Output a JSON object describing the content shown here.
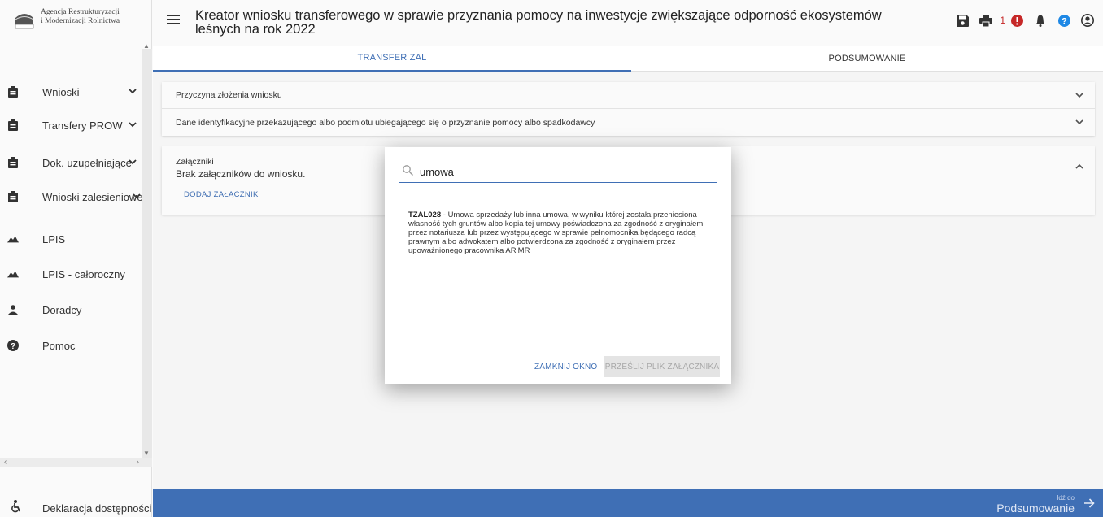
{
  "logo": {
    "line1": "Agencja Restrukturyzacji",
    "line2": "i Modernizacji Rolnictwa",
    "mark_text": "ARiMR"
  },
  "sidebar": {
    "items": [
      {
        "label": "Wnioski",
        "icon": "clipboard-icon",
        "has_chevron": true
      },
      {
        "label": "Transfery PROW",
        "icon": "clipboard-icon",
        "has_chevron": true
      },
      {
        "label": "Dok. uzupełniające",
        "icon": "clipboard-icon",
        "has_chevron": true
      },
      {
        "label": "Wnioski zalesieniowe",
        "icon": "clipboard-icon",
        "has_chevron": true
      },
      {
        "label": "LPIS",
        "icon": "terrain-icon",
        "has_chevron": false
      },
      {
        "label": "LPIS - całoroczny",
        "icon": "terrain-icon",
        "has_chevron": false
      },
      {
        "label": "Doradcy",
        "icon": "person-icon",
        "has_chevron": false
      },
      {
        "label": "Pomoc",
        "icon": "help-icon",
        "has_chevron": false
      }
    ],
    "accessibility_label": "Deklaracja dostępności"
  },
  "header": {
    "title": "Kreator wniosku transferowego w sprawie przyznania pomocy na inwestycje zwiększające odporność ekosystemów leśnych na rok 2022",
    "error_count": "1"
  },
  "tabs": [
    {
      "label": "TRANSFER ZAL",
      "active": true
    },
    {
      "label": "PODSUMOWANIE",
      "active": false
    }
  ],
  "sections": {
    "reason": "Przyczyna złożenia wniosku",
    "identification": "Dane identyfikacyjne przekazującego albo podmiotu ubiegającego się o przyznanie pomocy albo spadkodawcy",
    "attachments_title": "Załączniki",
    "attachments_empty": "Brak załączników do wniosku.",
    "add_attachment": "DODAJ ZAŁĄCZNIK"
  },
  "modal": {
    "search_value": "umowa",
    "result_code": "TZAL028",
    "result_text": " - Umowa sprzedaży lub inna umowa, w wyniku której została przeniesiona własność tych gruntów albo kopia tej umowy poświadczona za zgodność z oryginałem przez notariusza lub przez występującego w sprawie pełnomocnika będącego radcą prawnym albo adwokatem albo potwierdzona za zgodność z oryginałem przez upoważnionego pracownika ARiMR",
    "close_label": "ZAMKNIJ OKNO",
    "send_label": "PRZEŚLIJ PLIK ZAŁĄCZNIKA"
  },
  "footer": {
    "next_small": "Idź do",
    "next_big": "Podsumowanie"
  },
  "colors": {
    "accent": "#3f6fb5",
    "error": "#c62828",
    "help": "#1e88e5"
  }
}
